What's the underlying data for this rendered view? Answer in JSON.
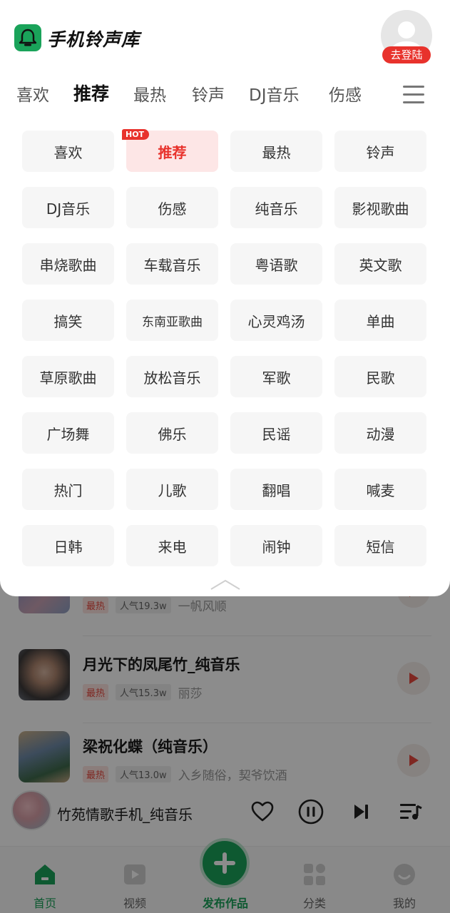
{
  "header": {
    "app_title": "手机铃声库",
    "login_label": "去登陆"
  },
  "tabs": [
    {
      "label": "喜欢",
      "active": false
    },
    {
      "label": "推荐",
      "active": true
    },
    {
      "label": "最热",
      "active": false
    },
    {
      "label": "铃声",
      "active": false
    },
    {
      "label": "DJ音乐",
      "active": false
    },
    {
      "label": "伤感",
      "active": false
    }
  ],
  "categories": [
    "喜欢",
    "推荐",
    "最热",
    "铃声",
    "DJ音乐",
    "伤感",
    "纯音乐",
    "影视歌曲",
    "串烧歌曲",
    "车载音乐",
    "粤语歌",
    "英文歌",
    "搞笑",
    "东南亚歌曲",
    "心灵鸡汤",
    "单曲",
    "草原歌曲",
    "放松音乐",
    "军歌",
    "民歌",
    "广场舞",
    "佛乐",
    "民谣",
    "动漫",
    "热门",
    "儿歌",
    "翻唱",
    "喊麦",
    "日韩",
    "来电",
    "闹钟",
    "短信"
  ],
  "hot_badge": "HOT",
  "songs": [
    {
      "title": "",
      "tag": "最热",
      "popularity": "人气19.3w",
      "artist": "一帆风顺"
    },
    {
      "title": "月光下的凤尾竹_纯音乐",
      "tag": "最热",
      "popularity": "人气15.3w",
      "artist": "丽莎"
    },
    {
      "title": "梁祝化蝶（纯音乐）",
      "tag": "最热",
      "popularity": "人气13.0w",
      "artist": "入乡随俗，契爷饮酒"
    }
  ],
  "player": {
    "now_playing": "竹苑情歌手机_纯音乐"
  },
  "bottom_nav": {
    "home": "首页",
    "video": "视频",
    "publish": "发布作品",
    "category": "分类",
    "mine": "我的"
  },
  "colors": {
    "accent": "#1aa35a",
    "hot": "#e8322c"
  }
}
